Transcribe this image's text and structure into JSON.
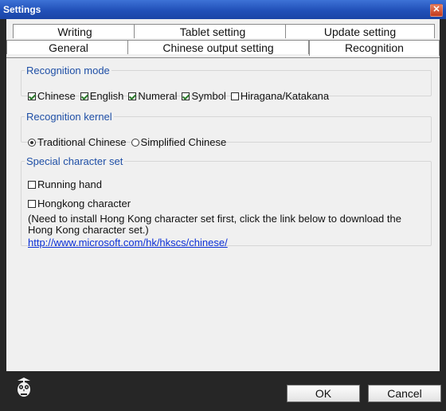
{
  "window": {
    "title": "Settings",
    "close_glyph": "✕"
  },
  "tabs_top": [
    {
      "label": "Writing"
    },
    {
      "label": "Tablet setting"
    },
    {
      "label": "Update setting"
    }
  ],
  "tabs_bottom": [
    {
      "label": "General"
    },
    {
      "label": "Chinese output setting"
    },
    {
      "label": "Recognition",
      "selected": true
    }
  ],
  "recognition_mode": {
    "legend": "Recognition mode",
    "options": [
      {
        "label": "Chinese",
        "checked": true
      },
      {
        "label": "English",
        "checked": true
      },
      {
        "label": "Numeral",
        "checked": true
      },
      {
        "label": "Symbol",
        "checked": true
      },
      {
        "label": "Hiragana/Katakana",
        "checked": false
      }
    ]
  },
  "recognition_kernel": {
    "legend": "Recognition kernel",
    "options": [
      {
        "label": "Traditional Chinese",
        "selected": true
      },
      {
        "label": "Simplified Chinese",
        "selected": false
      }
    ]
  },
  "special_set": {
    "legend": "Special character set",
    "options": [
      {
        "label": "Running hand",
        "checked": false
      },
      {
        "label": "Hongkong character",
        "checked": false
      }
    ],
    "note": "(Need to install Hong Kong character set first, click the link below to download the Hong Kong character set.)",
    "link": "http://www.microsoft.com/hk/hkscs/chinese/"
  },
  "buttons": {
    "ok": "OK",
    "cancel": "Cancel"
  },
  "colors": {
    "titlebar": "#2150b8",
    "legend": "#1f4fa6",
    "link": "#0a2fd6",
    "frame": "#262626"
  },
  "icons": {
    "app_logo": "owl-logo-icon",
    "close": "close-icon"
  }
}
